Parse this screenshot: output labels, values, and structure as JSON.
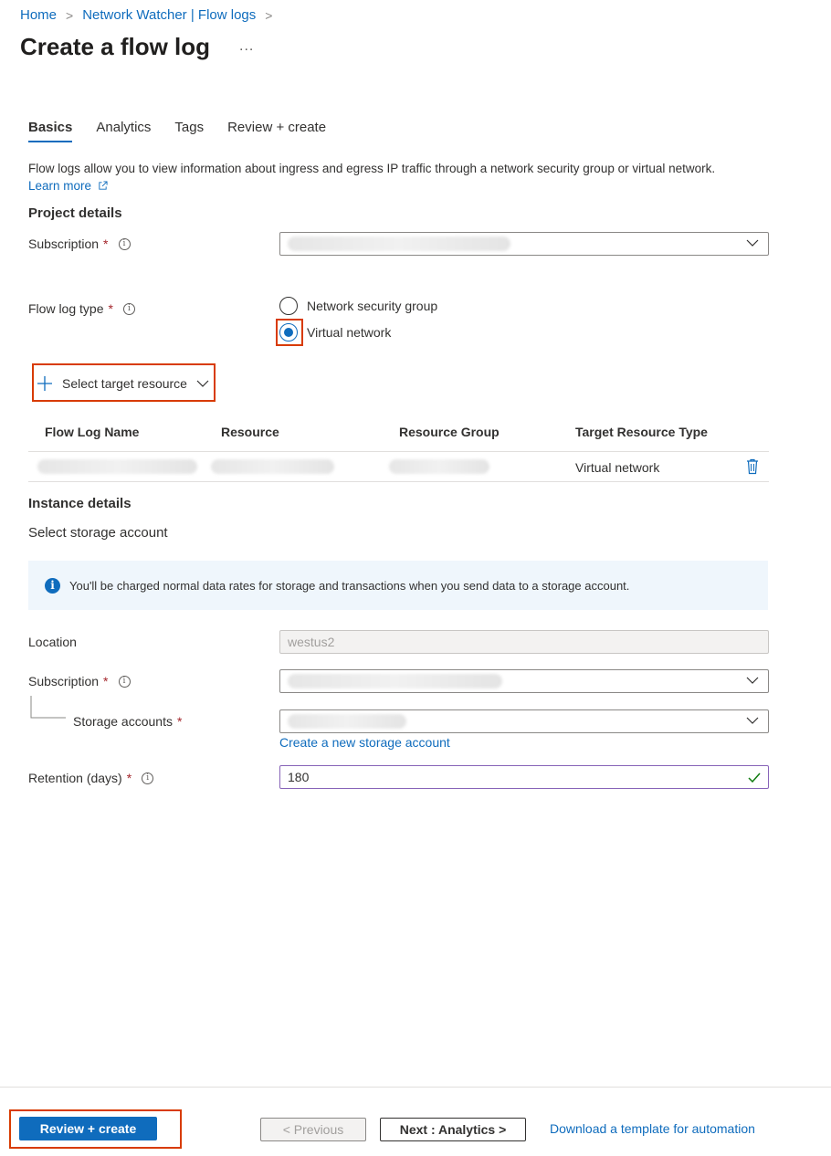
{
  "breadcrumb": {
    "home": "Home",
    "parent": "Network Watcher | Flow logs",
    "separator": ">"
  },
  "page": {
    "title": "Create a flow log",
    "more": "..."
  },
  "tabs": [
    {
      "label": "Basics",
      "active": true
    },
    {
      "label": "Analytics"
    },
    {
      "label": "Tags"
    },
    {
      "label": "Review + create"
    }
  ],
  "intro": {
    "text": "Flow logs allow you to view information about ingress and egress IP traffic through a network security group or virtual network.",
    "learn_more": "Learn more"
  },
  "project": {
    "heading": "Project details",
    "subscription_label": "Subscription",
    "flow_log_type_label": "Flow log type",
    "options": [
      "Network security group",
      "Virtual network"
    ],
    "selected": "Virtual network"
  },
  "target": {
    "button_label": "Select target resource"
  },
  "table": {
    "columns": [
      "Flow Log Name",
      "Resource",
      "Resource Group",
      "Target Resource Type"
    ],
    "rows": [
      {
        "target_type": "Virtual network"
      }
    ]
  },
  "instance": {
    "heading": "Instance details",
    "subheading": "Select storage account",
    "info": "You'll be charged normal data rates for storage and transactions when you send data to a storage account.",
    "location_label": "Location",
    "location_value": "westus2",
    "subscription_label": "Subscription",
    "storage_label": "Storage accounts",
    "create_storage_link": "Create a new storage account",
    "retention_label": "Retention (days)",
    "retention_value": "180"
  },
  "footer": {
    "review_create": "Review + create",
    "previous": "< Previous",
    "next": "Next : Analytics >",
    "download": "Download a template for automation"
  },
  "colors": {
    "accent": "#0f6cbd",
    "highlight": "#d83b01",
    "required": "#a4262c",
    "valid": "#107c10"
  }
}
